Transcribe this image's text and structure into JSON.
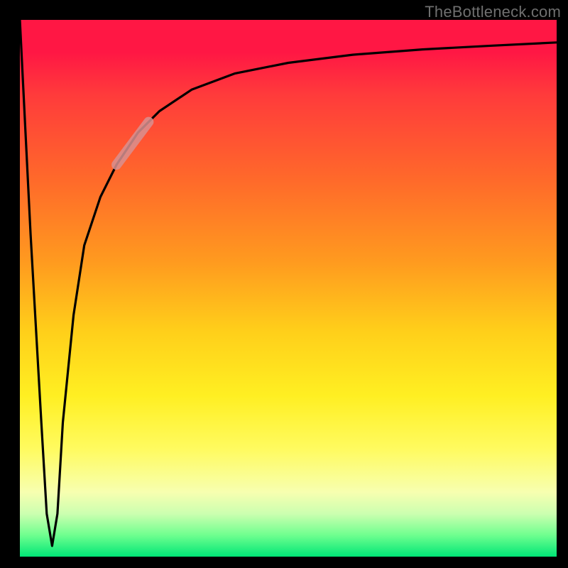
{
  "watermark": "TheBottleneck.com",
  "chart_data": {
    "type": "line",
    "title": "",
    "xlabel": "",
    "ylabel": "",
    "xlim": [
      0,
      100
    ],
    "ylim": [
      0,
      100
    ],
    "grid": false,
    "legend": false,
    "series": [
      {
        "name": "bottleneck-curve",
        "x": [
          0,
          2,
          4,
          5,
          6,
          7,
          8,
          10,
          12,
          15,
          18,
          22,
          26,
          32,
          40,
          50,
          62,
          75,
          88,
          100
        ],
        "values": [
          100,
          60,
          25,
          8,
          2,
          8,
          25,
          45,
          58,
          67,
          73,
          79,
          83,
          87,
          90,
          92,
          93.5,
          94.5,
          95.2,
          95.8
        ]
      }
    ],
    "highlight_segment": {
      "series": "bottleneck-curve",
      "x_start": 18,
      "x_end": 24,
      "y_start": 73,
      "y_end": 81,
      "color": "#d89090"
    },
    "gradient_stops": [
      {
        "pos": 0.0,
        "color": "#ff1744"
      },
      {
        "pos": 0.3,
        "color": "#ff6a2a"
      },
      {
        "pos": 0.58,
        "color": "#ffcf1a"
      },
      {
        "pos": 0.8,
        "color": "#fffb60"
      },
      {
        "pos": 0.96,
        "color": "#6fff8f"
      },
      {
        "pos": 1.0,
        "color": "#00e676"
      }
    ]
  }
}
